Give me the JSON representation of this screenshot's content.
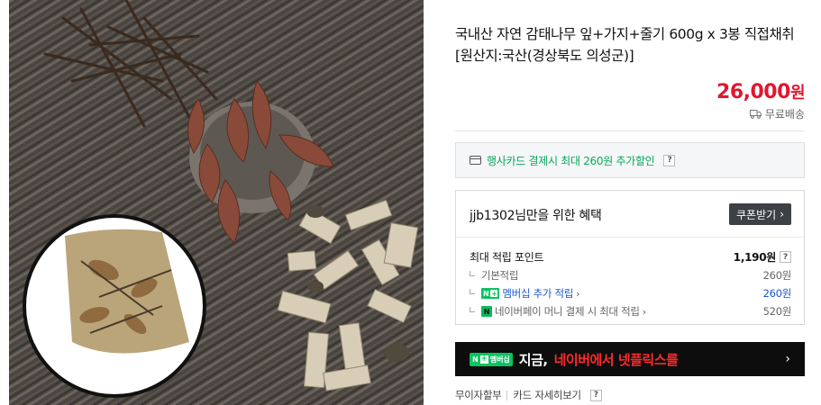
{
  "product": {
    "title": "국내산 자연 감태나무 잎+가지+줄기 600g x 3봉 직접채취 [원산지:국산(경상북도 의성군)]",
    "price_amount": "26,000",
    "price_unit": "원",
    "shipping": "무료배송"
  },
  "card_promo": {
    "text": "행사카드 결제시 최대 260원 추가할인",
    "help": "?"
  },
  "benefit": {
    "title": "jjb1302님만을 위한 혜택",
    "coupon_label": "쿠폰받기",
    "max_points_label": "최대 적립 포인트",
    "max_points_value": "1,190원",
    "help": "?",
    "rows": [
      {
        "label": "기본적립",
        "value": "260원"
      },
      {
        "label": "멤버십 추가 적립",
        "value": "260원"
      },
      {
        "label": "네이버페이 머니 결제 시 최대 적립",
        "value": "520원"
      }
    ]
  },
  "badges": {
    "membership_n": "N",
    "membership_plus": "+",
    "npay_n": "N",
    "banner_badge": "멤버십"
  },
  "banner": {
    "text_white": "지금,",
    "text_red": "네이버에서 넷플릭스를"
  },
  "payment_links": {
    "installment": "무이자할부",
    "card_detail": "카드 자세히보기",
    "help": "?"
  },
  "colors": {
    "price": "#e0182d",
    "naver_green": "#08c461",
    "promo_green": "#08a85a",
    "link_blue": "#1a57d4",
    "banner_bg": "#0d0d0d"
  }
}
